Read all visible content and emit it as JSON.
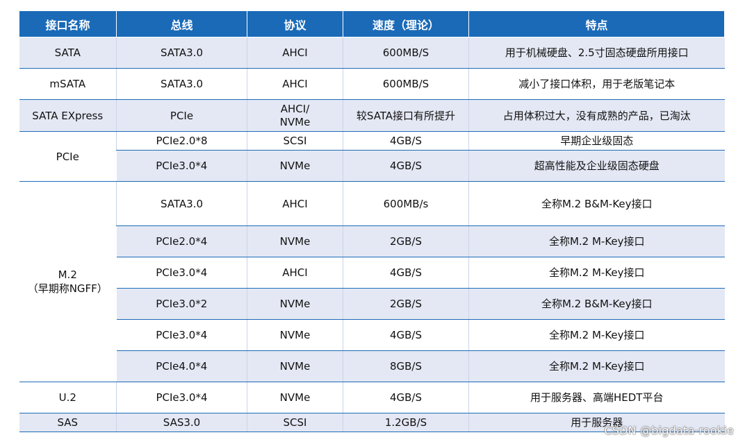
{
  "headers": [
    "接口名称",
    "总线",
    "协议",
    "速度（理论）",
    "特点"
  ],
  "rows": [
    {
      "iface": "SATA",
      "bus": "SATA3.0",
      "protocol": "AHCI",
      "speed": "600MB/S",
      "feature": "用于机械硬盘、2.5寸固态硬盘所用接口"
    },
    {
      "iface": "mSATA",
      "bus": "SATA3.0",
      "protocol": "AHCI",
      "speed": "600MB/S",
      "feature": "减小了接口体积，用于老版笔记本"
    },
    {
      "iface": "SATA EXpress",
      "bus": "PCIe",
      "protocol": "AHCI/\nNVMe",
      "speed": "较SATA接口有所提升",
      "feature": "占用体积过大，没有成熟的产品，已淘汰"
    },
    {
      "iface": "PCIe",
      "bus": "PCIe2.0*8",
      "protocol": "SCSI",
      "speed": "4GB/S",
      "feature": "早期企业级固态"
    },
    {
      "bus": "PCIe3.0*4",
      "protocol": "NVMe",
      "speed": "4GB/S",
      "feature": "超高性能及企业级固态硬盘"
    },
    {
      "iface": "M.2\n（早期称NGFF）",
      "bus": "SATA3.0",
      "protocol": "AHCI",
      "speed": "600MB/s",
      "feature": "全称M.2 B&M-Key接口"
    },
    {
      "bus": "PCIe2.0*4",
      "protocol": "NVMe",
      "speed": "2GB/S",
      "feature": "全称M.2 M-Key接口"
    },
    {
      "bus": "PCIe3.0*4",
      "protocol": "AHCI",
      "speed": "4GB/S",
      "feature": "全称M.2 M-Key接口"
    },
    {
      "bus": "PCIe3.0*2",
      "protocol": "NVMe",
      "speed": "2GB/S",
      "feature": "全称M.2 B&M-Key接口"
    },
    {
      "bus": "PCIe3.0*4",
      "protocol": "NVMe",
      "speed": "4GB/S",
      "feature": "全称M.2 M-Key接口"
    },
    {
      "bus": "PCIe4.0*4",
      "protocol": "NVMe",
      "speed": "8GB/S",
      "feature": "全称M.2 M-Key接口"
    },
    {
      "iface": "U.2",
      "bus": "PCIe3.0*4",
      "protocol": "NVMe",
      "speed": "4GB/S",
      "feature": "用于服务器、高端HEDT平台"
    },
    {
      "iface": "SAS",
      "bus": "SAS3.0",
      "protocol": "SCSI",
      "speed": "1.2GB/S",
      "feature": "用于服务器"
    }
  ],
  "watermark": "CSDN @bigdata-rookie"
}
